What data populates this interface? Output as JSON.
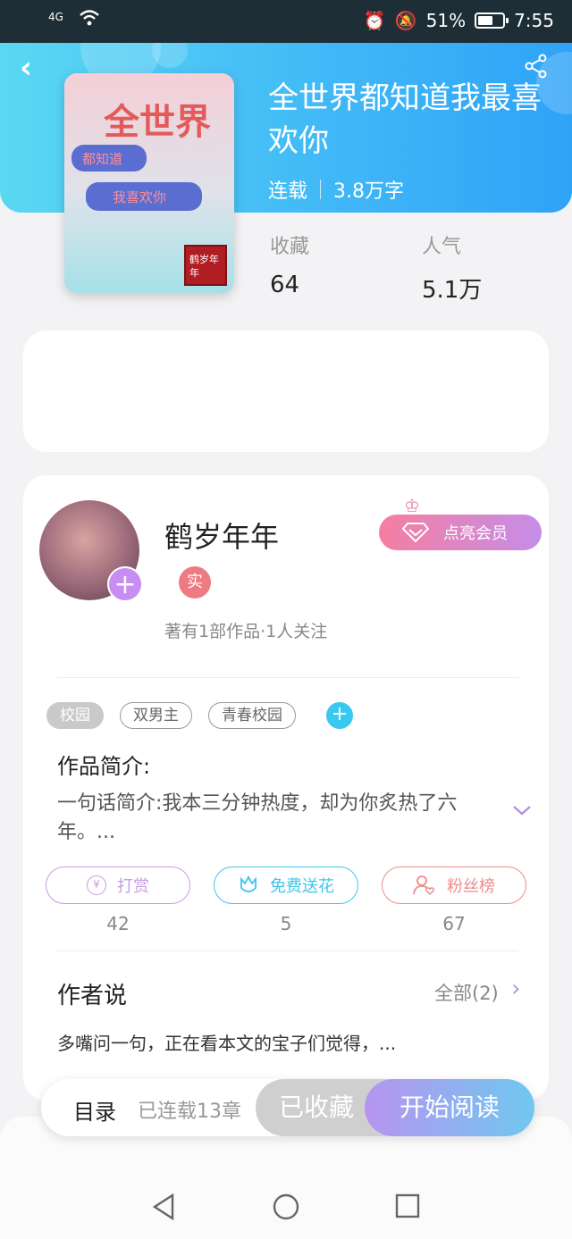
{
  "status_bar": {
    "signal": "4G",
    "battery": "51%",
    "time": "7:55"
  },
  "book": {
    "title": "全世界都知道我最喜欢你",
    "status": "连载",
    "word_count": "3.8万字",
    "cover": {
      "big_text": "全世界",
      "line1": "都知道",
      "line2": "我喜欢你",
      "seal": "鹤岁年年"
    }
  },
  "stats": [
    {
      "label": "收藏",
      "value": "64"
    },
    {
      "label": "人气",
      "value": "5.1万"
    }
  ],
  "author": {
    "name": "鹤岁年年",
    "badge": "实",
    "info": "著有1部作品·1人关注",
    "vip_label": "点亮会员"
  },
  "tags": [
    "校园",
    "双男主",
    "青春校园"
  ],
  "intro": {
    "heading": "作品简介:",
    "text": "一句话简介:我本三分钟热度，却为你炙热了六年。..."
  },
  "actions": [
    {
      "label": "打赏",
      "count": "42",
      "color": "#c79be6"
    },
    {
      "label": "免费送花",
      "count": "5",
      "color": "#3ec6ea"
    },
    {
      "label": "粉丝榜",
      "count": "67",
      "color": "#ee8c8c"
    }
  ],
  "author_says": {
    "heading": "作者说",
    "all_label": "全部(2)",
    "text": "多嘴问一句，正在看本文的宝子们觉得，..."
  },
  "bottom_bar": {
    "toc_label": "目录",
    "chapters_label": "已连载13章",
    "favorited_label": "已收藏",
    "read_label": "开始阅读"
  }
}
